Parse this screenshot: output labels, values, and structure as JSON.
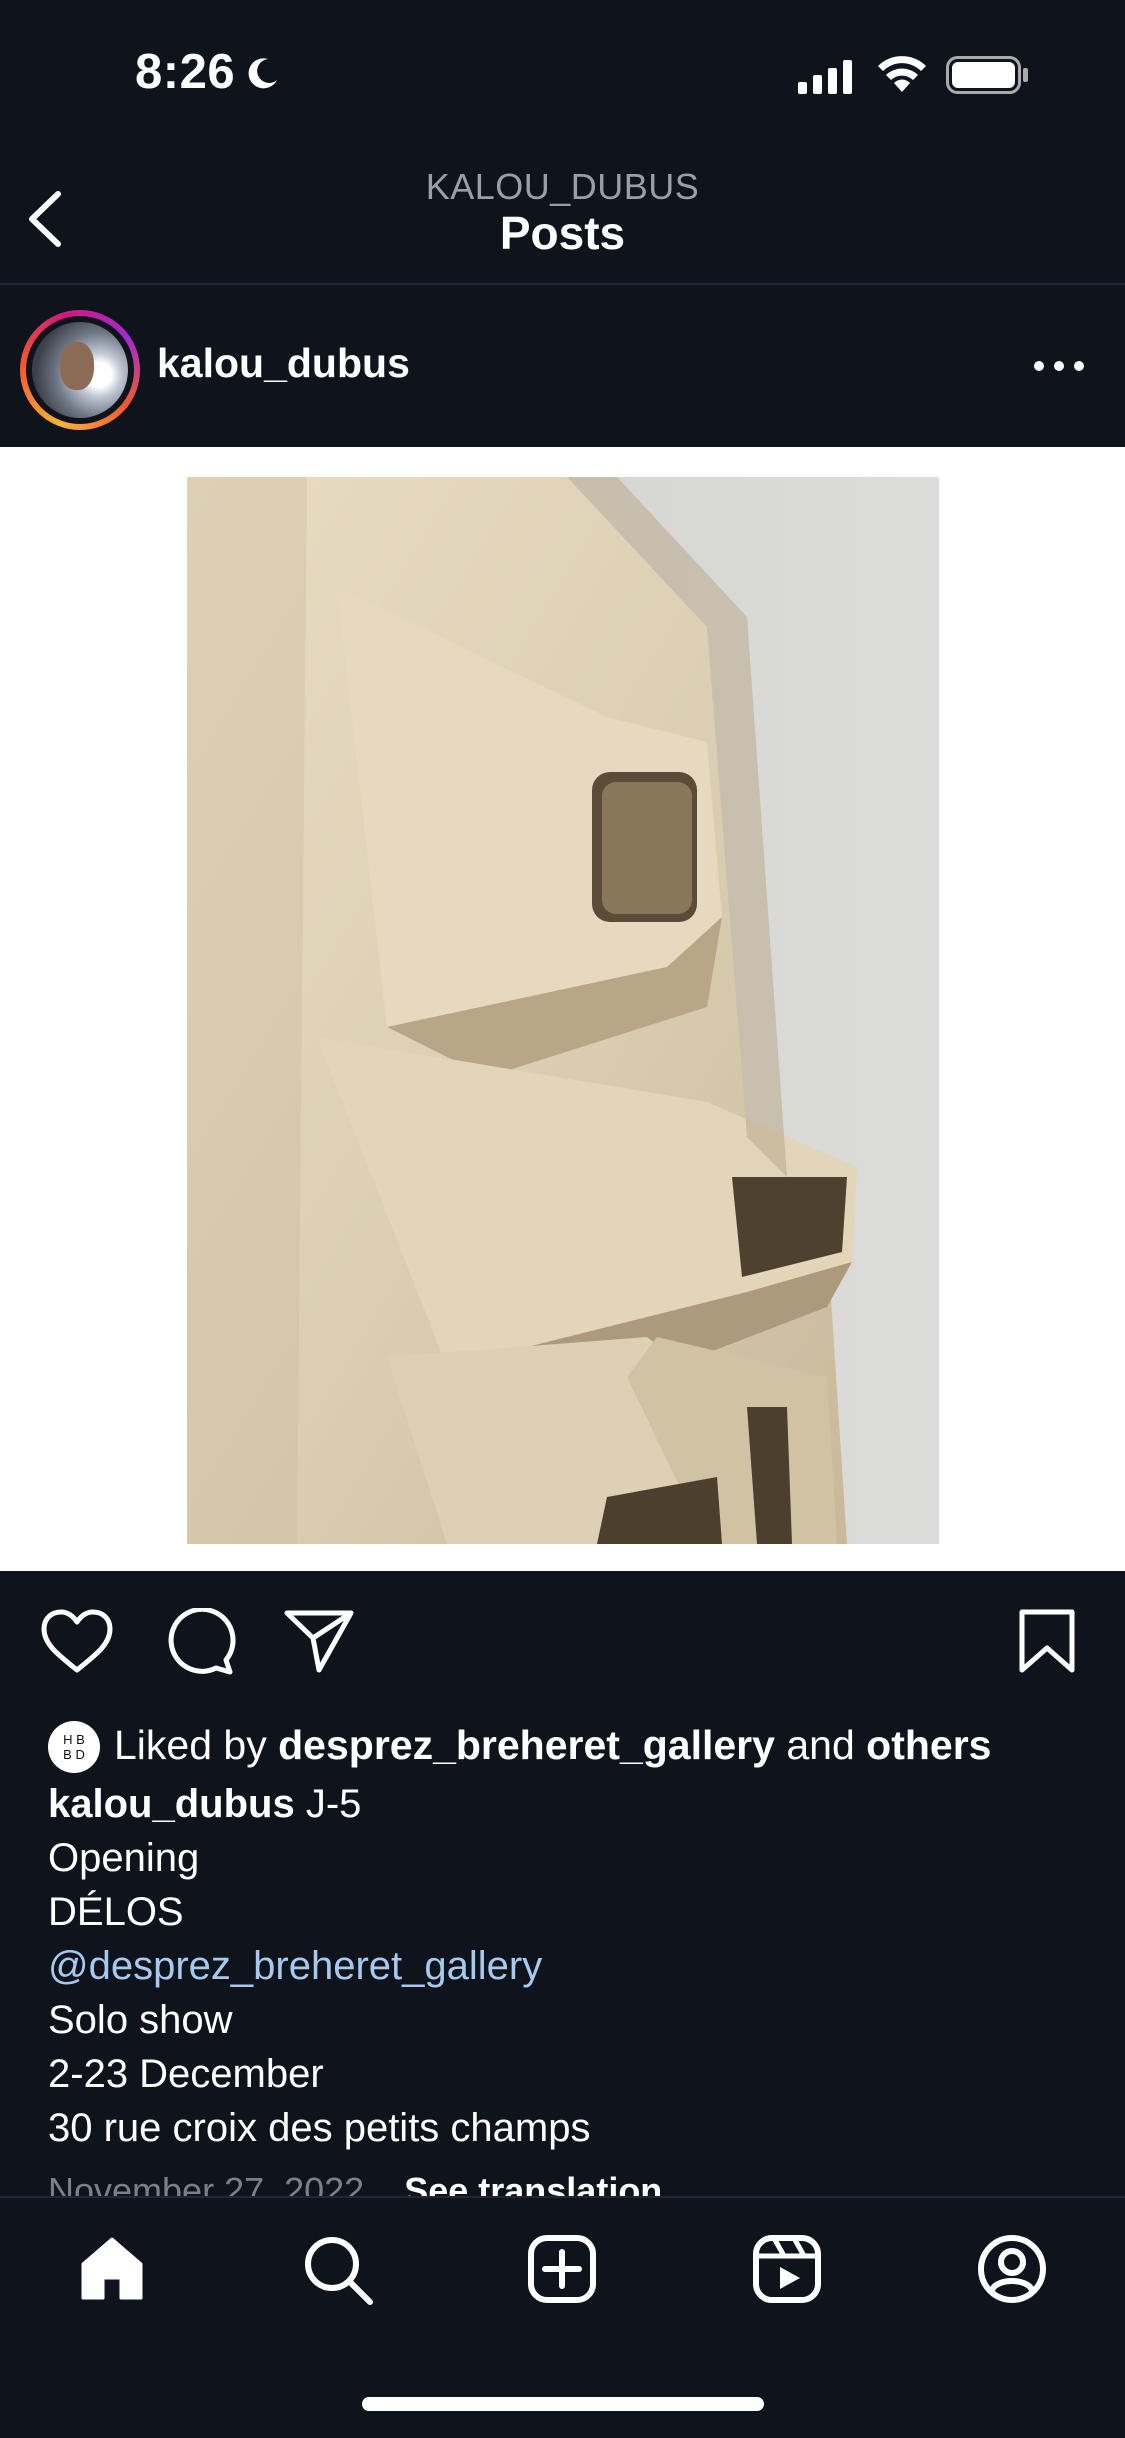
{
  "status": {
    "time": "8:26"
  },
  "header": {
    "username": "KALOU_DUBUS",
    "title": "Posts"
  },
  "post": {
    "username": "kalou_dubus",
    "liked_by_prefix": "Liked by",
    "liked_by_user": "desprez_breheret_gallery",
    "liked_by_and": "and",
    "liked_by_others": "others",
    "hb_logo": "H B\nB D",
    "caption_user": "kalou_dubus",
    "caption_first": "J-5",
    "caption_lines": [
      "Opening",
      "DÉLOS"
    ],
    "caption_mention": "@desprez_breheret_gallery",
    "caption_more": [
      "Solo show",
      "2-23 December",
      "30 rue croix des petits champs"
    ],
    "date": "November 27, 2022",
    "see_translation": "See translation"
  },
  "icons": {
    "status": [
      "moon-icon",
      "signal-icon",
      "wifi-icon",
      "battery-icon"
    ],
    "header": [
      "back-arrow-icon"
    ],
    "post": [
      "more-icon",
      "heart-icon",
      "comment-icon",
      "share-icon",
      "bookmark-icon"
    ],
    "nav": [
      "home-icon",
      "search-icon",
      "create-icon",
      "reels-icon",
      "profile-icon"
    ]
  }
}
